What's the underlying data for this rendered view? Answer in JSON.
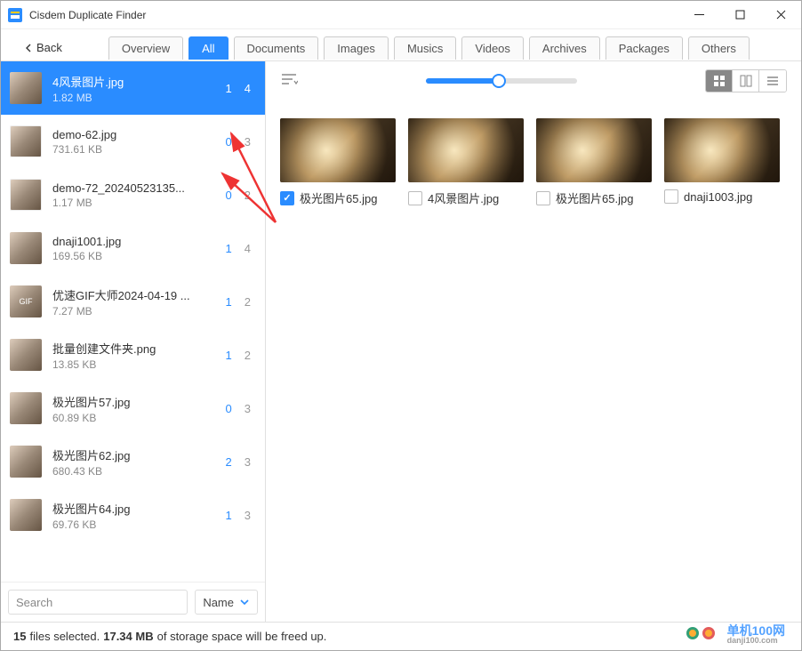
{
  "title": "Cisdem Duplicate Finder",
  "back": "Back",
  "tabs": [
    "Overview",
    "All",
    "Documents",
    "Images",
    "Musics",
    "Videos",
    "Archives",
    "Packages",
    "Others"
  ],
  "activeTab": 1,
  "items": [
    {
      "name": "4风景图片.jpg",
      "size": "1.82 MB",
      "c1": "1",
      "c2": "4",
      "sel": true,
      "th": ""
    },
    {
      "name": "demo-62.jpg",
      "size": "731.61 KB",
      "c1": "0",
      "c2": "3",
      "sel": false,
      "th": "th-white"
    },
    {
      "name": "demo-72_20240523135...",
      "size": "1.17 MB",
      "c1": "0",
      "c2": "2",
      "sel": false,
      "th": "th-white"
    },
    {
      "name": "dnaji1001.jpg",
      "size": "169.56 KB",
      "c1": "1",
      "c2": "4",
      "sel": false,
      "th": "th-person"
    },
    {
      "name": "优速GIF大师2024-04-19 ...",
      "size": "7.27 MB",
      "c1": "1",
      "c2": "2",
      "sel": false,
      "th": "th-gif"
    },
    {
      "name": "批量创建文件夹.png",
      "size": "13.85 KB",
      "c1": "1",
      "c2": "2",
      "sel": false,
      "th": "th-folder"
    },
    {
      "name": "极光图片57.jpg",
      "size": "60.89 KB",
      "c1": "0",
      "c2": "3",
      "sel": false,
      "th": "th-person"
    },
    {
      "name": "极光图片62.jpg",
      "size": "680.43 KB",
      "c1": "2",
      "c2": "3",
      "sel": false,
      "th": "th-blue"
    },
    {
      "name": "极光图片64.jpg",
      "size": "69.76 KB",
      "c1": "1",
      "c2": "3",
      "sel": false,
      "th": "th-red"
    }
  ],
  "searchPlaceholder": "Search",
  "sortLabel": "Name",
  "gridItems": [
    {
      "name": "极光图片65.jpg",
      "checked": true
    },
    {
      "name": "4风景图片.jpg",
      "checked": false
    },
    {
      "name": "极光图片65.jpg",
      "checked": false
    },
    {
      "name": "dnaji1003.jpg",
      "checked": false
    }
  ],
  "status": {
    "n": "15",
    "t1": " files selected.  ",
    "sz": "17.34 MB",
    "t2": "  of storage space will be freed up."
  },
  "watermark": "单机100网",
  "watersub": "danji100.com"
}
